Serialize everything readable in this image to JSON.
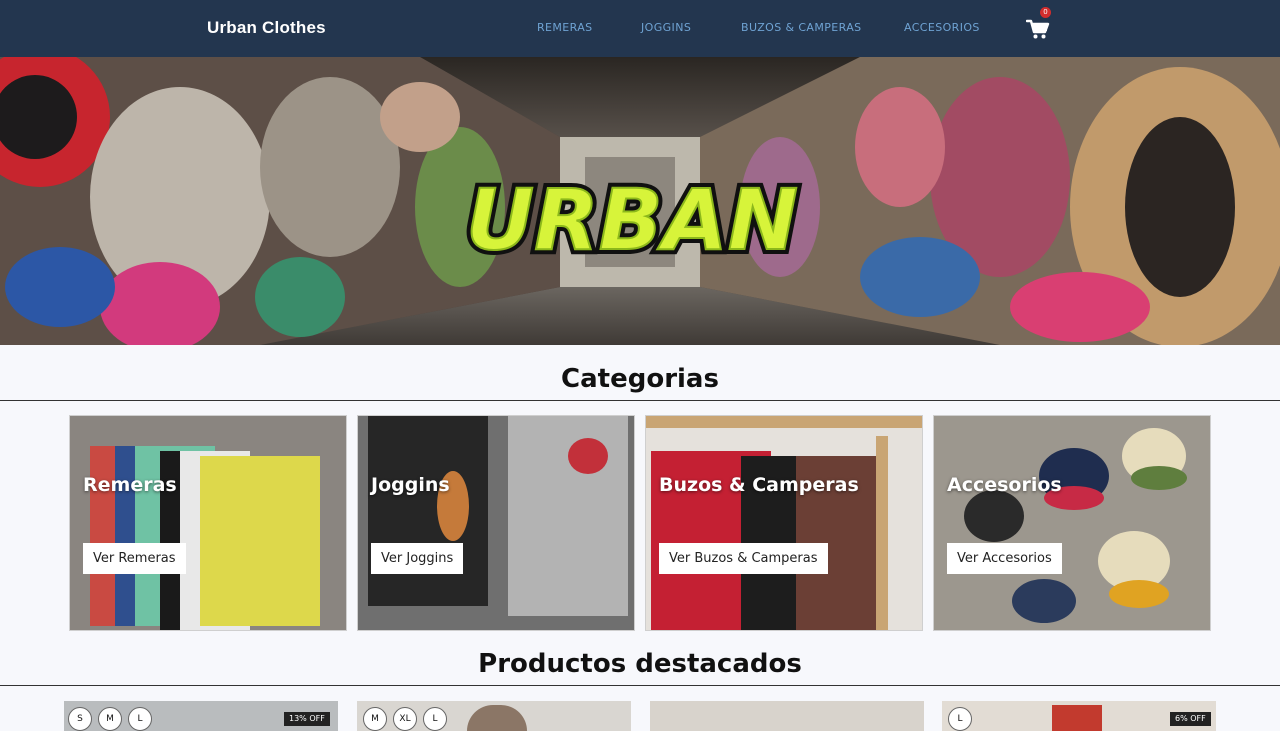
{
  "navbar": {
    "brand": "Urban Clothes",
    "links": [
      "REMERAS",
      "JOGGINS",
      "BUZOS & CAMPERAS",
      "ACCESORIOS"
    ],
    "cart_count": "0",
    "cart_icon": "cart-icon"
  },
  "hero": {
    "logo_text": "URBAN"
  },
  "categories": {
    "title": "Categorias",
    "items": [
      {
        "title": "Remeras",
        "button": "Ver Remeras"
      },
      {
        "title": "Joggins",
        "button": "Ver Joggins"
      },
      {
        "title": "Buzos & Camperas",
        "button": "Ver Buzos & Camperas"
      },
      {
        "title": "Accesorios",
        "button": "Ver Accesorios"
      }
    ]
  },
  "featured": {
    "title": "Productos destacados",
    "products": [
      {
        "sizes": [
          "S",
          "M",
          "L"
        ],
        "discount": "13% OFF"
      },
      {
        "sizes": [
          "M",
          "XL",
          "L"
        ],
        "discount": ""
      },
      {
        "sizes": [],
        "discount": ""
      },
      {
        "sizes": [
          "L"
        ],
        "discount": "6% OFF"
      }
    ]
  },
  "colors": {
    "navbar_bg": "#23364f",
    "nav_link": "#6fa3d3",
    "badge": "#d22d2d",
    "page_bg": "#f7f8fc"
  }
}
